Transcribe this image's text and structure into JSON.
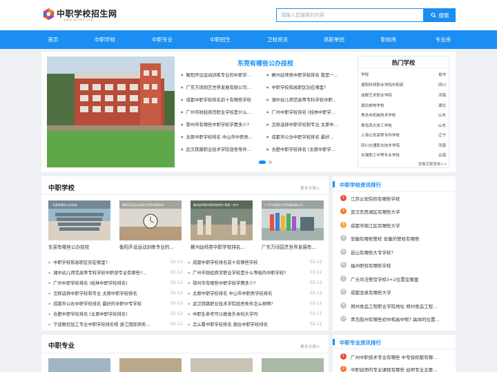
{
  "header": {
    "logo_title": "中职学校招生网",
    "logo_sub": "www.bjhao.com",
    "search_placeholder": "请输入您搜索的内容",
    "search_button": "搜索"
  },
  "nav": [
    "首页",
    "中职学校",
    "中职专业",
    "中职招生",
    "卫校资讯",
    "高职单招",
    "职校库",
    "专业库"
  ],
  "feature": {
    "title": "东莞有哪些公办技校",
    "headlines_left": [
      "衡阳开设运动训练专业的中职学...",
      "广东万顷园艺世界发展有限公司...",
      "成都中职学校排名前十有哪些学校",
      "广州市财经商贸职业学校是什么...",
      "鄂州市有哪些中职学校学费多少?",
      "太原中职学校排名 中山市中职类...",
      "武汉铁路职业技术学院宿舍条件..."
    ],
    "headlines_right": [
      "郴州幼师类中职学校排名 我是一...",
      "中职学校和高职区别在哪里?",
      "湘中幼儿师范高等专科学校中职...",
      "广州中职学校排名 (桂林中职学...",
      "怎样选择中职学校和专业 太原中...",
      "成都市公办中职学校排名 最好...",
      "合肥中职学校排名 (太原中职学..."
    ]
  },
  "hot": {
    "title": "热门学校",
    "schools": [
      {
        "name": "学校",
        "prov": "省市"
      },
      {
        "name": "德阳科贸职业学院中职部",
        "prov": "四川"
      },
      {
        "name": "成都艺术职业学院",
        "prov": "河南"
      },
      {
        "name": "湖北邮电学校",
        "prov": "湖北"
      },
      {
        "name": "青岛市机械技术学校",
        "prov": "山东"
      },
      {
        "name": "青岛西大技工学校",
        "prov": "山东"
      },
      {
        "name": "上海公安高等专科学校",
        "prov": "辽宁"
      },
      {
        "name": "四川交通职业技术学院",
        "prov": "河南"
      },
      {
        "name": "水钢职工中等专业学校",
        "prov": "云南"
      }
    ],
    "more": "查看完整表单>>"
  },
  "section1": {
    "title": "中职学校",
    "more": "更多文章>",
    "thumbs": [
      {
        "caption": "东莞有哪些公办技校",
        "overlay": "东莞有哪些公办技校"
      },
      {
        "caption": "衡阳开设运动训练专业的...",
        "overlay": "衡阳开设运动训练专业的中职学校"
      },
      {
        "caption": "郴州幼师类中职学校排名...",
        "overlay": "郴州幼师类中职学校排名 我是一名中"
      },
      {
        "caption": "广东万顷园艺世界发展有...",
        "overlay": "广东万顷园艺世界发展有限公司"
      }
    ],
    "list_left": [
      {
        "text": "中职学校和高职区别在哪里?",
        "date": "02-12"
      },
      {
        "text": "湘中幼儿师范高等专科学校中职部专业有哪些?...",
        "date": "02-12"
      },
      {
        "text": "广州中职学校排名 (桂林中职学校排名)",
        "date": "02-12"
      },
      {
        "text": "怎样选择中职学校和专业 太原中职学校排名",
        "date": "02-12"
      },
      {
        "text": "成都市公办中职学校排名 最好的中职中专学校",
        "date": "02-12"
      },
      {
        "text": "合肥中职学校排名 (太原中职学校排名)",
        "date": "02-12"
      },
      {
        "text": "宁波数控加工专业中职学校排名榜 浙江国际商务...",
        "date": "02-12"
      }
    ],
    "list_right": [
      {
        "text": "成都中职学校排名前十有哪些学校",
        "date": "02-12"
      },
      {
        "text": "广州市财经商贸职业学校是什么等级的中职学校?",
        "date": "02-12"
      },
      {
        "text": "鄂州市有哪些中职学校学费多少?",
        "date": "02-12"
      },
      {
        "text": "太原中职学校排名 中山市中职类学校排名",
        "date": "02-12"
      },
      {
        "text": "武汉铁路职业技术学院宿舍条件怎么样啊?",
        "date": "02-12"
      },
      {
        "text": "中职生参考可以报省外本科大学吗",
        "date": "02-12"
      },
      {
        "text": "怎么看中职学校排名 烟台中职学校排名",
        "date": "02-12"
      }
    ]
  },
  "section2": {
    "title": "中职专业",
    "more": "更多文章>"
  },
  "rank1": {
    "title": "中职学校资讯排行",
    "items": [
      "江苏公安院校有哪些学校",
      "武汉东西湖区有哪些大学",
      "成都市锦江区有哪些大学",
      "安徽有哪些警校 安徽的警校有哪些",
      "昆山有哪些大专学校?",
      "福州职校有哪些学校",
      "广元司法警官学校3+2位置在哪里",
      "成都龙泉有哪些大学",
      "郑州食品工程职业学院地址 郑州食品工程...",
      "青岛胶州有哪些初中和高中呢? 具体的位置..."
    ]
  },
  "rank2": {
    "title": "中职专业资讯排行",
    "items": [
      "广州中职技术专业有哪些 中专技校都有哪...",
      "中职幼师的专业课程有哪些 幼师专业主要..."
    ]
  },
  "colors": {
    "accent": "#1a8ef2",
    "rank_red": "#e84b3a",
    "rank_orange": "#f07b2d",
    "rank_yellow": "#f3a63c",
    "rank_gray": "#c2c7cf"
  }
}
